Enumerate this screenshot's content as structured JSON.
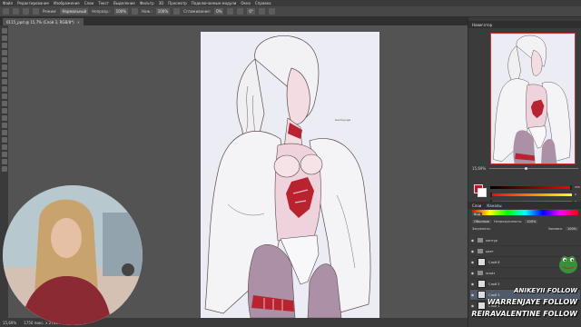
{
  "menu": [
    "Файл",
    "Редактирование",
    "Изображение",
    "Слои",
    "Текст",
    "Выделение",
    "Фильтр",
    "3D",
    "Просмотр",
    "Подключаемые модули",
    "Окно",
    "Справка"
  ],
  "options": {
    "mode_label": "Режим:",
    "mode_value": "Нормальный",
    "opacity_label": "Непрозр.:",
    "opacity_value": "100%",
    "pressure_label": "Наж.:",
    "pressure_value": "100%",
    "smoothing_label": "Сглаживание:",
    "smoothing_value": "0%",
    "angle_value": "0°"
  },
  "document": {
    "tab_title": "0115_ppd @ 15,7% (Слой 3, RGB/8*)",
    "close": "×"
  },
  "status": {
    "zoom": "15,69%",
    "info": "1750 пикс. x 2700 пикс. (96 ppi)"
  },
  "canvas": {
    "signature": "teedrayuga"
  },
  "navigator": {
    "title": "Навигатор",
    "zoom": "15,69%"
  },
  "color": {
    "fg": "#c0142c",
    "bg": "#ffffff",
    "values": [
      "255",
      "0",
      "0"
    ]
  },
  "layers": {
    "tabs": [
      "Слои",
      "Каналы"
    ],
    "search": "Вид",
    "blend": "Обычные",
    "opacity_label": "Непрозрачность:",
    "opacity_value": "100%",
    "lock_label": "Закрепить:",
    "fill_label": "Заливка:",
    "fill_value": "100%",
    "items": [
      {
        "name": "контур",
        "type": "folder"
      },
      {
        "name": "цвет",
        "type": "folder"
      },
      {
        "name": "Слой 8",
        "type": "layer"
      },
      {
        "name": "эскиз",
        "type": "folder"
      },
      {
        "name": "Слой 5",
        "type": "layer"
      },
      {
        "name": "Слой 3",
        "type": "layer",
        "active": true
      },
      {
        "name": "Слой 1",
        "type": "layer"
      }
    ]
  },
  "overlay": [
    "ANIKEYII FOLLOW",
    "WARRENJAYE FOLLOW",
    "REIRAVALENTINE FOLLOW"
  ]
}
